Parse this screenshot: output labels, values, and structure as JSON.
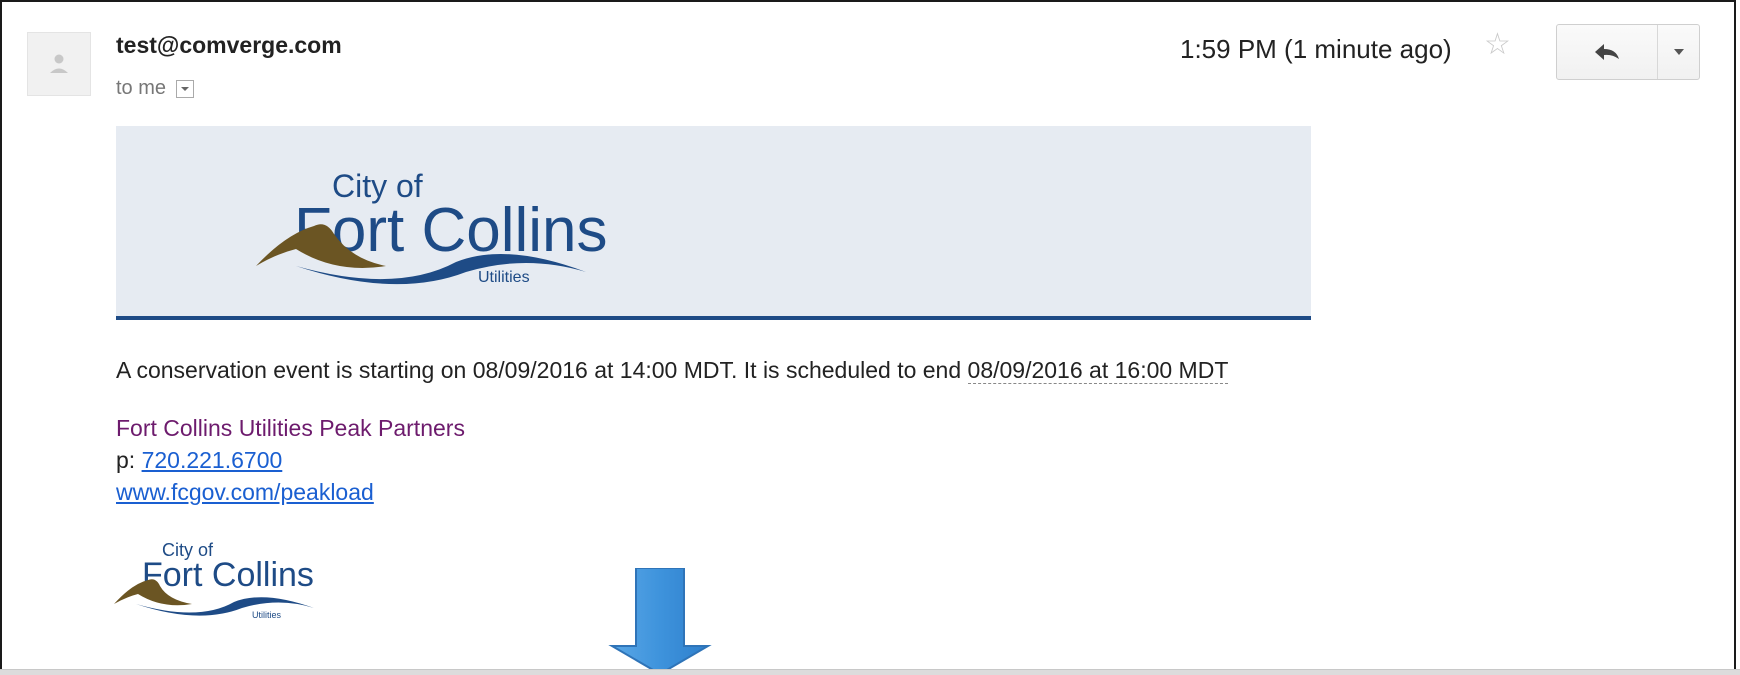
{
  "email": {
    "sender": "test@comverge.com",
    "recipient_label": "to me",
    "time": "1:59 PM (1 minute ago)"
  },
  "icons": {
    "avatar": "person-icon",
    "recipient_dropdown": "chevron-down-icon",
    "star": "star-icon",
    "reply": "reply-icon",
    "more": "chevron-down-icon"
  },
  "banner": {
    "logo_alt": "City of Fort Collins Utilities logo",
    "logo_lines": {
      "line1": "City of",
      "line2": "Fort Collins",
      "line3": "Utilities"
    },
    "background": "#e6ebf2",
    "rule_color": "#1e4b86"
  },
  "message": {
    "text_before_date": "A conservation event is starting on 08/09/2016 at 14:00 MDT. It is scheduled to end ",
    "end_datetime": "08/09/2016 at 16:00 MDT"
  },
  "signature": {
    "name": "Fort Collins Utilities Peak Partners",
    "phone_label": "p: ",
    "phone": "720.221.6700",
    "url": "www.fcgov.com/peakload",
    "name_color": "#6d1b6d"
  },
  "overlay": {
    "arrow_icon": "down-arrow-icon",
    "arrow_color": "#3e93dc"
  }
}
